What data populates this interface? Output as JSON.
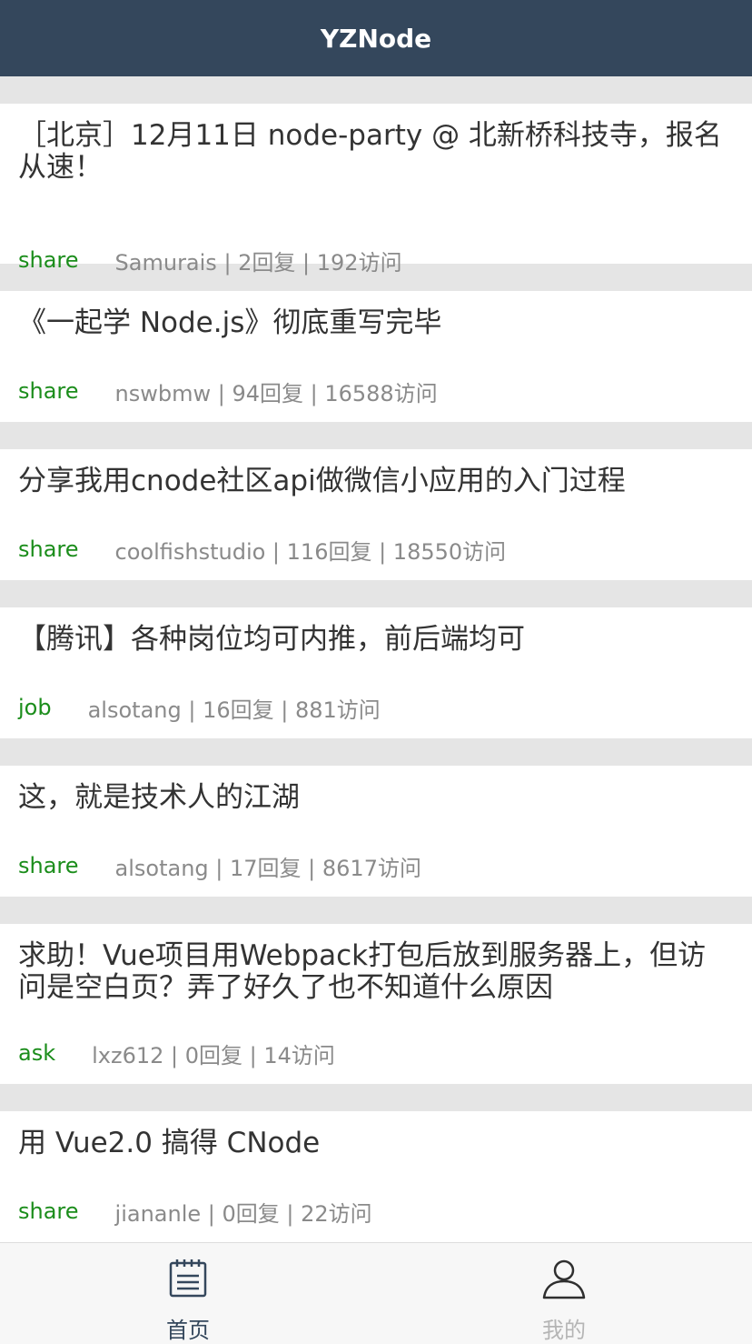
{
  "header": {
    "title": "YZNode"
  },
  "topics": [
    {
      "title": "［北京］12月11日 node-party @ 北新桥科技寺，报名从速！",
      "tab": "share",
      "meta": "Samurais | 2回复 | 192访问"
    },
    {
      "title": "《一起学 Node.js》彻底重写完毕",
      "tab": "share",
      "meta": "nswbmw | 94回复 | 16588访问"
    },
    {
      "title": "分享我用cnode社区api做微信小应用的入门过程",
      "tab": "share",
      "meta": "coolfishstudio | 116回复 | 18550访问"
    },
    {
      "title": "【腾讯】各种岗位均可内推，前后端均可",
      "tab": "job",
      "meta": "alsotang | 16回复 | 881访问"
    },
    {
      "title": "这，就是技术人的江湖",
      "tab": "share",
      "meta": "alsotang | 17回复 | 8617访问"
    },
    {
      "title": "求助！Vue项目用Webpack打包后放到服务器上，但访问是空白页？弄了好久了也不知道什么原因",
      "tab": "ask",
      "meta": "lxz612 | 0回复 | 14访问"
    },
    {
      "title": "用 Vue2.0 搞得 CNode",
      "tab": "share",
      "meta": "jiananle | 0回复 | 22访问"
    }
  ],
  "tabbar": {
    "home": {
      "label": "首页",
      "icon": "notepad-icon",
      "color": "#34475c"
    },
    "mine": {
      "label": "我的",
      "icon": "user-icon",
      "color": "#b5b5b5"
    }
  }
}
